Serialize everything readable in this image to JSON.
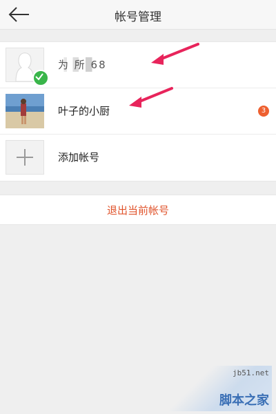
{
  "header": {
    "title": "帐号管理",
    "back_icon": "arrow-left-icon"
  },
  "accounts": [
    {
      "name": "为  所  68",
      "active": true,
      "badge": null
    },
    {
      "name": "叶子的小厨",
      "active": false,
      "badge": "3"
    }
  ],
  "add_account": {
    "label": "添加帐号",
    "icon": "plus-icon"
  },
  "logout": {
    "label": "退出当前帐号"
  },
  "watermark": {
    "site": "jb51.net",
    "text": "脚本之家"
  },
  "colors": {
    "accent": "#e0522a",
    "badge": "#ee6030",
    "check": "#39b54a",
    "arrow": "#e8245b",
    "background": "#efefef"
  }
}
